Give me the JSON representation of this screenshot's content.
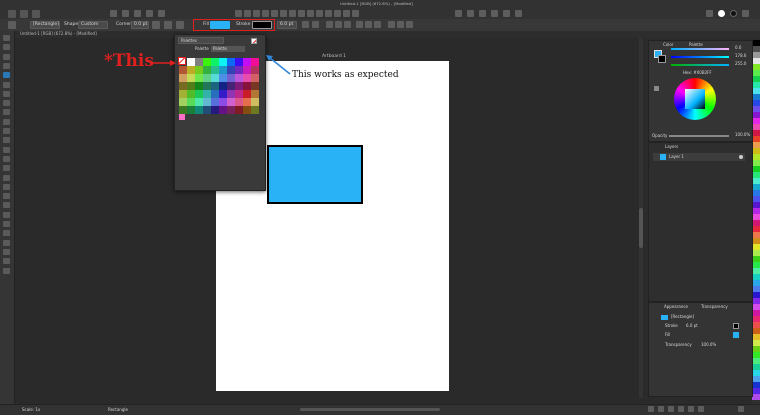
{
  "window": {
    "title": "Untitled-1 [RGB] (672.8%) - [Modified]"
  },
  "toolbar": {
    "preset": "[Rectangle]",
    "shape_label": "Shape",
    "shape_value": "Custom",
    "corner_label": "Corner",
    "corner_value": "0.0 pt",
    "fill_label": "Fill",
    "stroke_label": "Stroke",
    "stroke_width": "6.0 pt"
  },
  "doc_tab": {
    "label": "Untitled-1 [RGB] (672.8%) - [Modified]"
  },
  "artboard": {
    "label": "Artboard 1"
  },
  "palette_popup": {
    "dropdown": "Palettes",
    "tab_palette": "Palette",
    "tab_palette2": "Palette"
  },
  "annotation": {
    "this_label": "*This",
    "works_label": "This works as expected",
    "annot_color": "#e0201f",
    "arrow_color": "#2f86d6"
  },
  "color_panel": {
    "tab1": "Color",
    "tab2": "Palette",
    "r_value": "0.0",
    "g_value": "178.6",
    "b_value": "255.0",
    "hex": "Hex: #00B2FF",
    "opacity_label": "Opacity",
    "opacity_value": "100.0%"
  },
  "layers_panel": {
    "title": "Layers",
    "layer_name": "Layer 1"
  },
  "appearance_panel": {
    "tab1": "Appearance",
    "tab2": "Transparency",
    "object": "[Rectangle]",
    "stroke_label": "Stroke",
    "stroke_value": "6.0 pt",
    "fill_label": "Fill",
    "transparency_label": "Transparency",
    "transparency_value": "100.0%"
  },
  "status_bar": {
    "zoom": "Scale: 1x",
    "position": "Rectangle"
  },
  "colors": {
    "accent": "#29b2f5",
    "rect_fill": "#29b2f5",
    "stroke_color": "#000000"
  },
  "swatches": [
    "#ffffff",
    "#000000",
    "#ff0000",
    "#00ff00",
    "#0000ff",
    "#ffff00",
    "#ff00ff",
    "#00ffff",
    "#ff8000",
    "#8000ff"
  ]
}
